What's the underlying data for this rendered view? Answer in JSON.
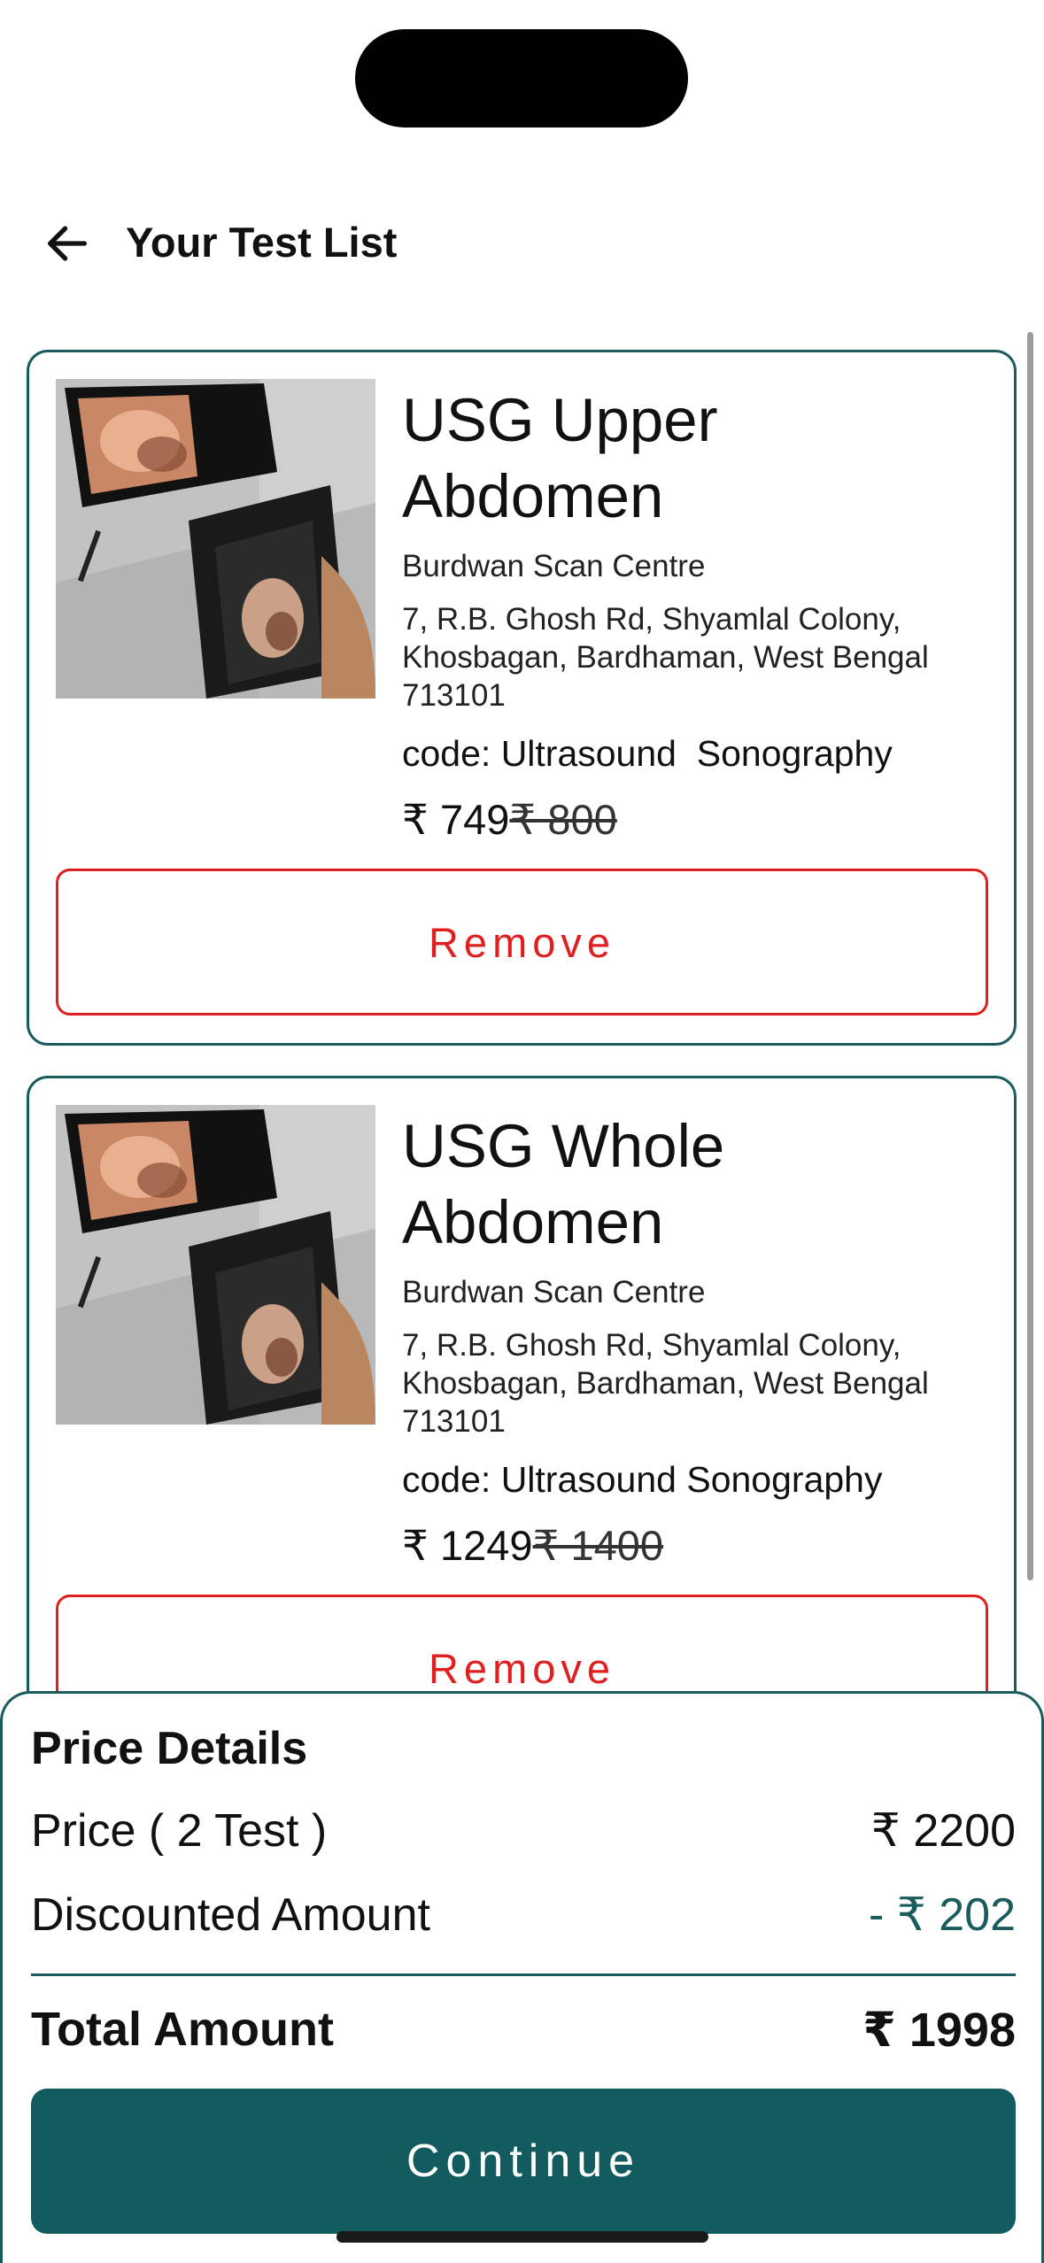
{
  "header": {
    "back_icon": "arrow-left-icon",
    "title": "Your Test List"
  },
  "tests": [
    {
      "image_icon": "ultrasound-photo",
      "name": "USG Upper Abdomen",
      "centre": "Burdwan Scan Centre",
      "address": "7, R.B. Ghosh Rd, Shyamlal Colony, Khosbagan, Bardhaman, West Bengal 713101",
      "code": "code: Ultrasound  Sonography",
      "price": "₹ 749",
      "original_price": "₹ 800",
      "remove_label": "Remove"
    },
    {
      "image_icon": "ultrasound-photo",
      "name": "USG Whole Abdomen",
      "centre": "Burdwan Scan Centre",
      "address": "7, R.B. Ghosh Rd, Shyamlal Colony, Khosbagan, Bardhaman, West Bengal 713101",
      "code": "code: Ultrasound Sonography",
      "price": "₹ 1249",
      "original_price": "₹ 1400",
      "remove_label": "Remove"
    }
  ],
  "price_details": {
    "heading": "Price Details",
    "price_label": "Price ( 2 Test )",
    "price_value": "₹ 2200",
    "discount_label": "Discounted Amount",
    "discount_value": "- ₹ 202",
    "total_label": "Total Amount",
    "total_value": "₹ 1998",
    "continue_label": "Continue"
  },
  "colors": {
    "primary": "#125b5e",
    "border": "#1a5c5e",
    "remove": "#e02020",
    "discount": "#1a5c5e"
  }
}
